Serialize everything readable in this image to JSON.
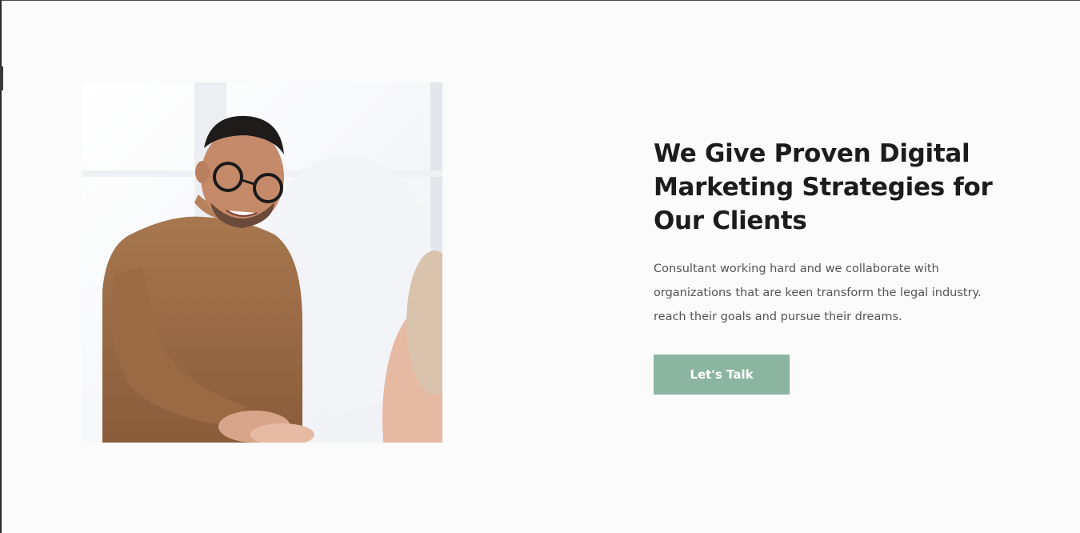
{
  "hero": {
    "headline": "We Give Proven Digital Marketing Strategies for Our Clients",
    "description": "Consultant working hard and we collaborate with organizations that are keen transform the legal industry. reach their goals and pursue their dreams.",
    "cta_label": "Let's Talk"
  },
  "colors": {
    "background": "#fbfbfb",
    "heading": "#1c1c1c",
    "body_text": "#555555",
    "button_bg": "#8bb5a1",
    "button_text": "#ffffff"
  }
}
